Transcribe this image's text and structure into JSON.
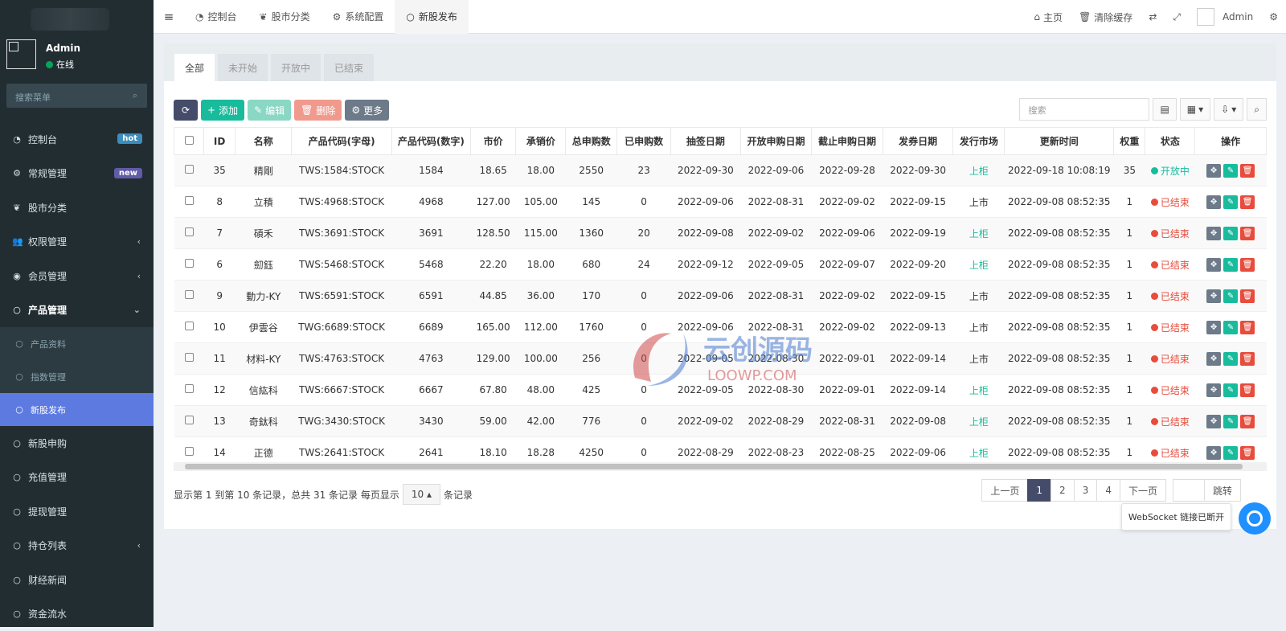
{
  "user": {
    "name": "Admin",
    "status": "在线",
    "status_color": "#00a65a"
  },
  "sidebar": {
    "search_placeholder": "搜索菜单",
    "items": [
      {
        "label": "控制台",
        "icon": "dashboard-icon",
        "badge": "hot",
        "badge_color": "#3c8dbc"
      },
      {
        "label": "常规管理",
        "icon": "cogs-icon",
        "badge": "new",
        "badge_color": "#605ca8"
      },
      {
        "label": "股市分类",
        "icon": "leaf-icon"
      },
      {
        "label": "权限管理",
        "icon": "group-icon",
        "chevron": "‹"
      },
      {
        "label": "会员管理",
        "icon": "user-circle-icon",
        "chevron": "‹"
      },
      {
        "label": "产品管理",
        "icon": "circle-icon",
        "chevron": "⌄"
      }
    ],
    "sub_items": [
      {
        "label": "产品资料"
      },
      {
        "label": "指数管理"
      },
      {
        "label": "新股发布"
      }
    ],
    "items2": [
      {
        "label": "新股申购"
      },
      {
        "label": "充值管理"
      },
      {
        "label": "提现管理"
      },
      {
        "label": "持仓列表",
        "chevron": "‹"
      },
      {
        "label": "财经新闻"
      },
      {
        "label": "资金流水"
      }
    ]
  },
  "header": {
    "tabs": [
      {
        "label": "控制台",
        "icon": "dashboard-icon"
      },
      {
        "label": "股市分类",
        "icon": "leaf-icon"
      },
      {
        "label": "系统配置",
        "icon": "gear-icon"
      },
      {
        "label": "新股发布",
        "icon": "circle-icon"
      }
    ],
    "right": {
      "home": "主页",
      "clear_cache": "清除缓存",
      "user": "Admin"
    }
  },
  "content": {
    "tabs": [
      "全部",
      "未开始",
      "开放中",
      "已结束"
    ],
    "toolbar": {
      "add": "添加",
      "edit": "编辑",
      "delete": "删除",
      "more": "更多"
    },
    "search_placeholder": "搜索",
    "columns": [
      "ID",
      "名称",
      "产品代码(字母)",
      "产品代码(数字)",
      "市价",
      "承销价",
      "总申购数",
      "已申购数",
      "抽签日期",
      "开放申购日期",
      "截止申购日期",
      "发券日期",
      "发行市场",
      "更新时间",
      "权重",
      "状态",
      "操作"
    ],
    "rows": [
      [
        "35",
        "精剛",
        "TWS:1584:STOCK",
        "1584",
        "18.65",
        "18.00",
        "2550",
        "23",
        "2022-09-30",
        "2022-09-06",
        "2022-09-28",
        "2022-09-30",
        "上柜",
        "2022-09-18 10:08:19",
        "35",
        "开放中"
      ],
      [
        "8",
        "立積",
        "TWS:4968:STOCK",
        "4968",
        "127.00",
        "105.00",
        "145",
        "0",
        "2022-09-06",
        "2022-08-31",
        "2022-09-02",
        "2022-09-15",
        "上市",
        "2022-09-08 08:52:35",
        "1",
        "已结束"
      ],
      [
        "7",
        "碩禾",
        "TWS:3691:STOCK",
        "3691",
        "128.50",
        "115.00",
        "1360",
        "20",
        "2022-09-08",
        "2022-09-02",
        "2022-09-06",
        "2022-09-19",
        "上柜",
        "2022-09-08 08:52:35",
        "1",
        "已结束"
      ],
      [
        "6",
        "劎鈺",
        "TWS:5468:STOCK",
        "5468",
        "22.20",
        "18.00",
        "680",
        "24",
        "2022-09-12",
        "2022-09-05",
        "2022-09-07",
        "2022-09-20",
        "上柜",
        "2022-09-08 08:52:35",
        "1",
        "已结束"
      ],
      [
        "9",
        "動力-KY",
        "TWS:6591:STOCK",
        "6591",
        "44.85",
        "36.00",
        "170",
        "0",
        "2022-09-06",
        "2022-08-31",
        "2022-09-02",
        "2022-09-15",
        "上市",
        "2022-09-08 08:52:35",
        "1",
        "已结束"
      ],
      [
        "10",
        "伊雲谷",
        "TWG:6689:STOCK",
        "6689",
        "165.00",
        "112.00",
        "1760",
        "0",
        "2022-09-06",
        "2022-08-31",
        "2022-09-02",
        "2022-09-13",
        "上市",
        "2022-09-08 08:52:35",
        "1",
        "已结束"
      ],
      [
        "11",
        "材料-KY",
        "TWS:4763:STOCK",
        "4763",
        "129.00",
        "100.00",
        "256",
        "0",
        "2022-09-05",
        "2022-08-30",
        "2022-09-01",
        "2022-09-14",
        "上市",
        "2022-09-08 08:52:35",
        "1",
        "已结束"
      ],
      [
        "12",
        "信紘科",
        "TWS:6667:STOCK",
        "6667",
        "67.80",
        "48.00",
        "425",
        "0",
        "2022-09-05",
        "2022-08-30",
        "2022-09-01",
        "2022-09-14",
        "上柜",
        "2022-09-08 08:52:35",
        "1",
        "已结束"
      ],
      [
        "13",
        "奇鈦科",
        "TWG:3430:STOCK",
        "3430",
        "59.00",
        "42.00",
        "776",
        "0",
        "2022-09-02",
        "2022-08-29",
        "2022-08-31",
        "2022-09-08",
        "上柜",
        "2022-09-08 08:52:35",
        "1",
        "已结束"
      ],
      [
        "14",
        "正德",
        "TWS:2641:STOCK",
        "2641",
        "18.10",
        "18.28",
        "4250",
        "0",
        "2022-08-29",
        "2022-08-23",
        "2022-08-25",
        "2022-09-06",
        "上柜",
        "2022-09-08 08:52:35",
        "1",
        "已结束"
      ]
    ],
    "footer": {
      "summary": "显示第 1 到第 10 条记录，总共 31 条记录 每页显示",
      "page_size": "10 ▴",
      "suffix": "条记录"
    },
    "pager": {
      "prev": "上一页",
      "pages": [
        "1",
        "2",
        "3",
        "4"
      ],
      "next": "下一页",
      "jump": "跳转"
    }
  },
  "toast": "WebSocket 链接已断开",
  "watermark": {
    "main": "云创源码",
    "sub": "LOOWP.COM"
  }
}
